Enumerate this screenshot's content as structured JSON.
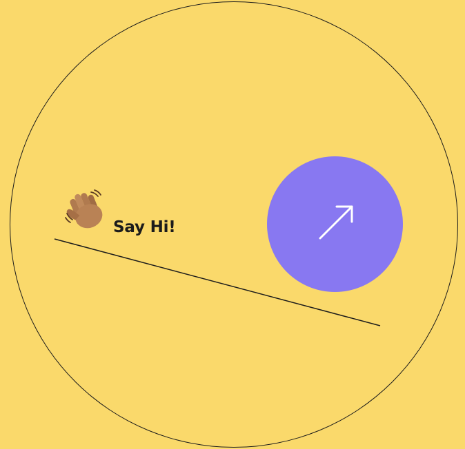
{
  "colors": {
    "background": "#FAD96B",
    "outline": "#1b1b1b",
    "button": "#8878F1",
    "arrow": "#ffffff"
  },
  "cta": {
    "label": "Say Hi!",
    "icon": "waving-hand-icon"
  },
  "action_button": {
    "icon": "arrow-up-right-icon"
  }
}
